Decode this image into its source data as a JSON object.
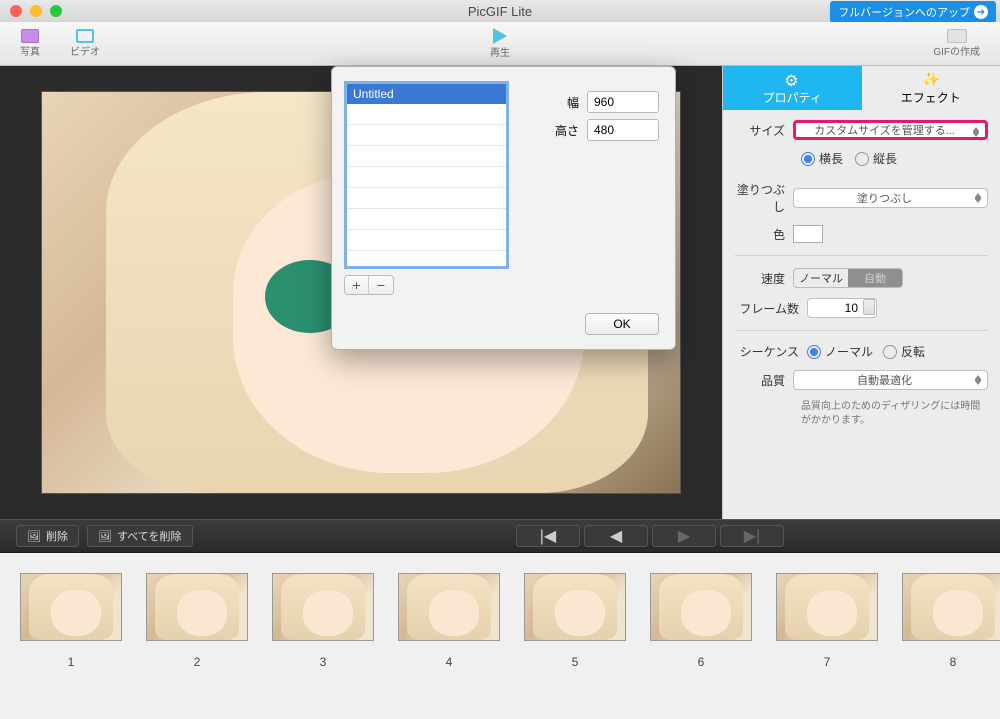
{
  "app": {
    "title": "PicGIF Lite",
    "upgrade_label": "フルバージョンへのアップ"
  },
  "toolbar": {
    "photo": "写真",
    "video": "ビデオ",
    "play": "再生",
    "create_gif": "GIFの作成"
  },
  "dialog": {
    "list_selected": "Untitled",
    "width_label": "幅",
    "width_value": "960",
    "height_label": "高さ",
    "height_value": "480",
    "add": "+",
    "remove": "−",
    "ok": "OK"
  },
  "props": {
    "tab_property": "プロパティ",
    "tab_effect": "エフェクト",
    "size_label": "サイズ",
    "size_value": "カスタムサイズを管理する...",
    "orient_h": "横長",
    "orient_v": "縦長",
    "fill_label": "塗りつぶし",
    "fill_value": "塗りつぶし",
    "color_label": "色",
    "speed_label": "速度",
    "speed_normal": "ノーマル",
    "speed_auto": "自動",
    "frames_label": "フレーム数",
    "frames_value": "10",
    "sequence_label": "シーケンス",
    "seq_normal": "ノーマル",
    "seq_reverse": "反転",
    "quality_label": "品質",
    "quality_value": "自動最適化",
    "quality_hint": "品質向上のためのディザリングには時間がかかります。"
  },
  "bottombar": {
    "delete": "削除",
    "delete_all": "すべてを削除"
  },
  "frames": [
    "1",
    "2",
    "3",
    "4",
    "5",
    "6",
    "7",
    "8"
  ]
}
